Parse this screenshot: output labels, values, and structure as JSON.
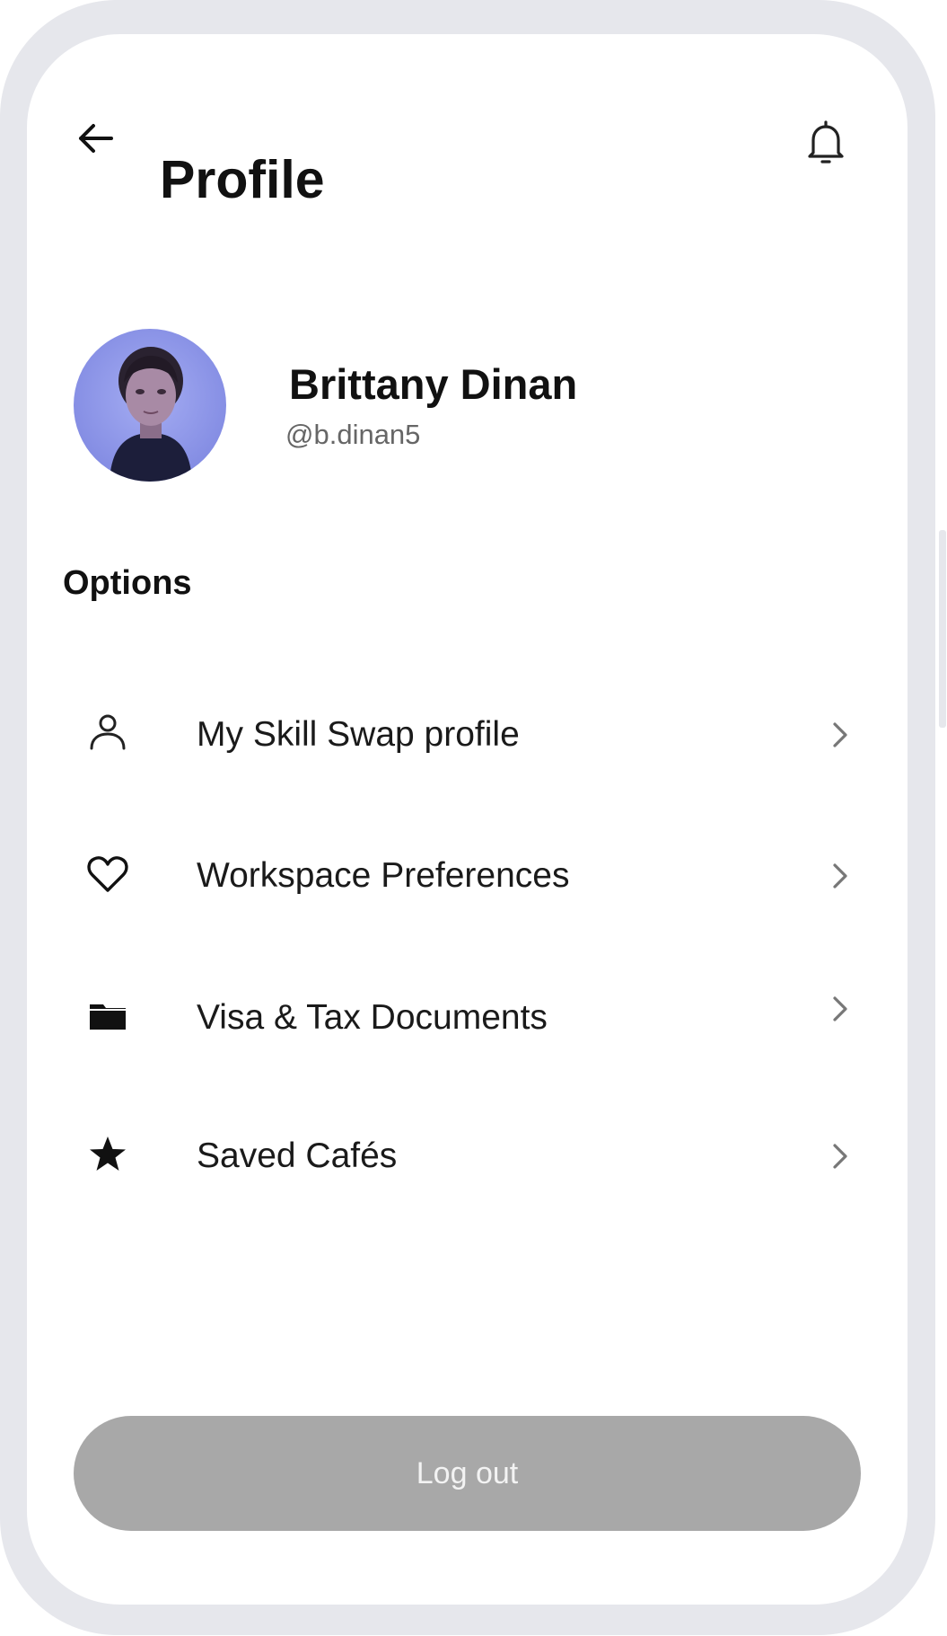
{
  "header": {
    "back_icon": "arrow-left-icon",
    "title": "Profile",
    "notifications_icon": "bell-icon"
  },
  "user": {
    "name": "Brittany Dinan",
    "handle": "@b.dinan5",
    "avatar": "user-avatar-photo"
  },
  "options": {
    "title": "Options",
    "items": [
      {
        "label": "My Skill Swap profile",
        "icon": "person-icon"
      },
      {
        "label": "Workspace Preferences",
        "icon": "heart-icon"
      },
      {
        "label": "Visa & Tax Documents",
        "icon": "folder-icon"
      },
      {
        "label": "Saved Cafés",
        "icon": "star-icon"
      }
    ],
    "chevron_icon": "chevron-right-icon"
  },
  "logout": {
    "label": "Log out"
  },
  "colors": {
    "frame": "#e6e7ec",
    "screen": "#ffffff",
    "text_primary": "#111111",
    "text_secondary": "#666666",
    "logout_bg": "#a8a8a8",
    "logout_text": "#f3f3f3"
  }
}
